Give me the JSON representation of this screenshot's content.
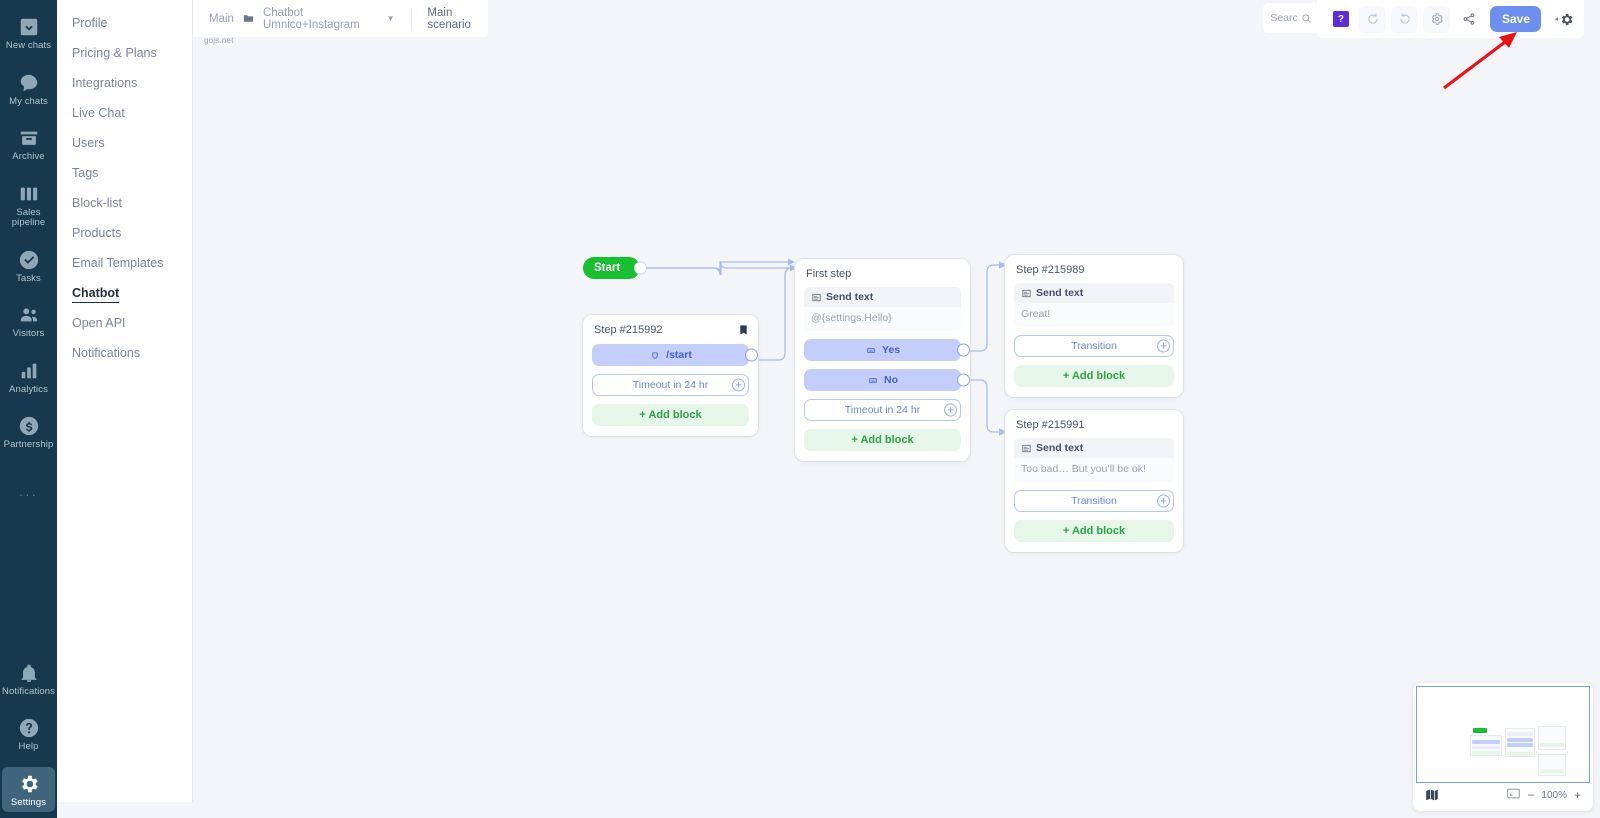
{
  "rail": {
    "items": [
      {
        "label": "New chats",
        "icon": "download-box-icon"
      },
      {
        "label": "My chats",
        "icon": "chat-bubble-icon"
      },
      {
        "label": "Archive",
        "icon": "archive-icon"
      },
      {
        "label": "Sales\npipeline",
        "icon": "columns-icon"
      },
      {
        "label": "Tasks",
        "icon": "check-circle-icon"
      },
      {
        "label": "Visitors",
        "icon": "users-icon"
      },
      {
        "label": "Analytics",
        "icon": "bar-chart-icon"
      },
      {
        "label": "Partnership",
        "icon": "dollar-circle-icon"
      }
    ],
    "dots": "···",
    "bottom": [
      {
        "label": "Notifications",
        "icon": "bell-icon",
        "active": false
      },
      {
        "label": "Help",
        "icon": "question-circle-icon",
        "active": false
      },
      {
        "label": "Settings",
        "icon": "gear-icon",
        "active": true
      }
    ]
  },
  "submenu": {
    "items": [
      {
        "label": "Profile",
        "active": false
      },
      {
        "label": "Pricing & Plans",
        "active": false
      },
      {
        "label": "Integrations",
        "active": false
      },
      {
        "label": "Live Chat",
        "active": false
      },
      {
        "label": "Users",
        "active": false
      },
      {
        "label": "Tags",
        "active": false
      },
      {
        "label": "Block-list",
        "active": false
      },
      {
        "label": "Products",
        "active": false
      },
      {
        "label": "Email Templates",
        "active": false
      },
      {
        "label": "Chatbot",
        "active": true
      },
      {
        "label": "Open API",
        "active": false
      },
      {
        "label": "Notifications",
        "active": false
      }
    ]
  },
  "breadcrumb": {
    "root": "Main",
    "bot": "Chatbot Umnico+Instagram",
    "caret": "▼",
    "scenario": "Main scenario"
  },
  "watermark": "gojs.net",
  "toolbar": {
    "search_placeholder": "Searc",
    "help_badge": "?",
    "undo_title": "undo",
    "redo_title": "redo",
    "settings_title": "settings",
    "share_title": "share",
    "save_label": "Save"
  },
  "flow": {
    "start": {
      "label": "Start"
    },
    "nodes": [
      {
        "id": "step-215992",
        "title": "Step #215992",
        "bookmarked": true,
        "rows": [
          {
            "kind": "blue",
            "label": "/start",
            "icon": "command-icon",
            "port": "circle"
          },
          {
            "kind": "outline",
            "label": "Timeout in 24 hr",
            "port": "plus"
          },
          {
            "kind": "green",
            "label": "+ Add block"
          }
        ]
      },
      {
        "id": "first-step",
        "title": "First step",
        "block": {
          "header": "Send text",
          "body": "@{settings.Hello}"
        },
        "rows": [
          {
            "kind": "blue",
            "label": "Yes",
            "icon": "keyboard-icon",
            "port": "circle"
          },
          {
            "kind": "blue",
            "label": "No",
            "icon": "keyboard-icon",
            "port": "circle"
          },
          {
            "kind": "outline",
            "label": "Timeout in 24 hr",
            "port": "plus"
          },
          {
            "kind": "green",
            "label": "+ Add block"
          }
        ]
      },
      {
        "id": "step-215989",
        "title": "Step #215989",
        "block": {
          "header": "Send text",
          "body": "Great!"
        },
        "rows": [
          {
            "kind": "outline",
            "label": "Transition",
            "port": "plus"
          },
          {
            "kind": "green",
            "label": "+ Add block"
          }
        ]
      },
      {
        "id": "step-215991",
        "title": "Step #215991",
        "block": {
          "header": "Send text",
          "body": "Too bad… But you’ll be ok!"
        },
        "rows": [
          {
            "kind": "outline",
            "label": "Transition",
            "port": "plus"
          },
          {
            "kind": "green",
            "label": "+ Add block"
          }
        ]
      }
    ]
  },
  "minimap": {
    "zoom_label": "100%",
    "zoom_out": "−",
    "zoom_in": "+",
    "map_icon": "map-icon",
    "fit_icon": "fit-to-screen-icon"
  },
  "annotation": {
    "arrow": "red-arrow-to-save"
  },
  "colors": {
    "rail_bg": "#16394d",
    "canvas_bg": "#f4f5f8",
    "accent_blue": "#6d8ff0",
    "start_green": "#18bf2e",
    "add_block_green": "#2aa544",
    "badge_purple": "#5b2de0",
    "annotation_red": "#ee1111"
  }
}
